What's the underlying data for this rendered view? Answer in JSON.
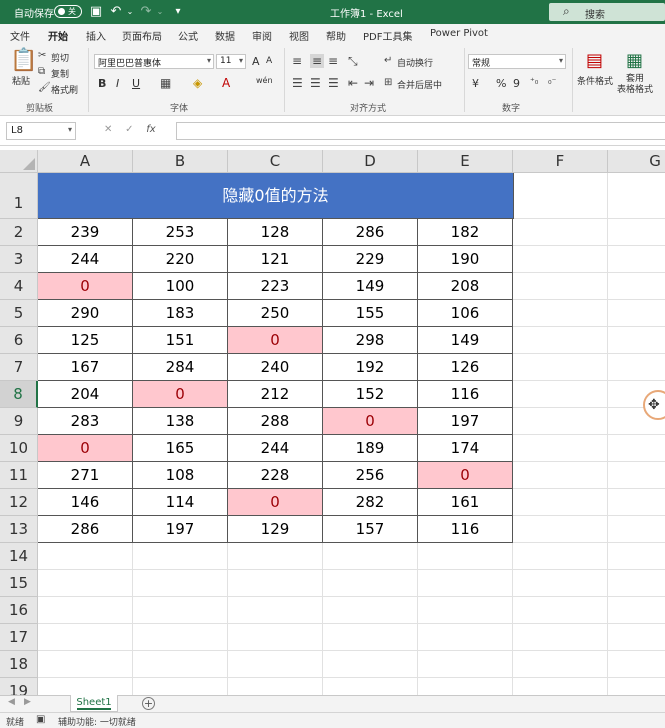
{
  "titlebar": {
    "autosave_label": "自动保存",
    "autosave_state": "关",
    "doc_title": "工作簿1 - Excel",
    "search_placeholder": "搜索"
  },
  "tabs": [
    "文件",
    "开始",
    "插入",
    "页面布局",
    "公式",
    "数据",
    "审阅",
    "视图",
    "帮助",
    "PDF工具集",
    "Power Pivot"
  ],
  "active_tab": "开始",
  "ribbon": {
    "clipboard": {
      "paste": "粘贴",
      "cut": "剪切",
      "copy": "复制",
      "format_painter": "格式刷",
      "label": "剪贴板"
    },
    "font": {
      "name": "阿里巴巴普惠体",
      "size": "11",
      "bold": "B",
      "italic": "I",
      "underline": "U",
      "grow": "A",
      "shrink": "A",
      "label": "字体",
      "font_color": "A",
      "phonetic": "wén"
    },
    "alignment": {
      "wrap": "自动换行",
      "merge": "合并后居中",
      "label": "对齐方式"
    },
    "number": {
      "format": "常规",
      "percent": "%",
      "comma": "9",
      "label": "数字",
      "currency": "¥"
    },
    "styles": {
      "conditional": "条件格式",
      "table_format": "套用\n表格格式"
    }
  },
  "formula_bar": {
    "name_box": "L8",
    "fx": "fx",
    "formula": ""
  },
  "grid": {
    "columns": [
      "A",
      "B",
      "C",
      "D",
      "E",
      "F",
      "G"
    ],
    "rows": [
      "1",
      "2",
      "3",
      "4",
      "5",
      "6",
      "7",
      "8",
      "9",
      "10",
      "11",
      "12",
      "13",
      "14",
      "15",
      "16",
      "17",
      "18",
      "19"
    ],
    "selected_row": "8",
    "title": "隐藏0值的方法",
    "data": [
      [
        239,
        253,
        128,
        286,
        182
      ],
      [
        244,
        220,
        121,
        229,
        190
      ],
      [
        0,
        100,
        223,
        149,
        208
      ],
      [
        290,
        183,
        250,
        155,
        106
      ],
      [
        125,
        151,
        0,
        298,
        149
      ],
      [
        167,
        284,
        240,
        192,
        126
      ],
      [
        204,
        0,
        212,
        152,
        116
      ],
      [
        283,
        138,
        288,
        0,
        197
      ],
      [
        0,
        165,
        244,
        189,
        174
      ],
      [
        271,
        108,
        228,
        256,
        0
      ],
      [
        146,
        114,
        0,
        282,
        161
      ],
      [
        286,
        197,
        129,
        157,
        116
      ]
    ],
    "highlight_color": "#ffc7ce",
    "title_fill": "#4472c4"
  },
  "sheets": [
    "Sheet1"
  ],
  "status": {
    "ready": "就绪",
    "accessibility": "辅助功能: 一切就绪"
  },
  "colors": {
    "excel_green": "#217346"
  }
}
